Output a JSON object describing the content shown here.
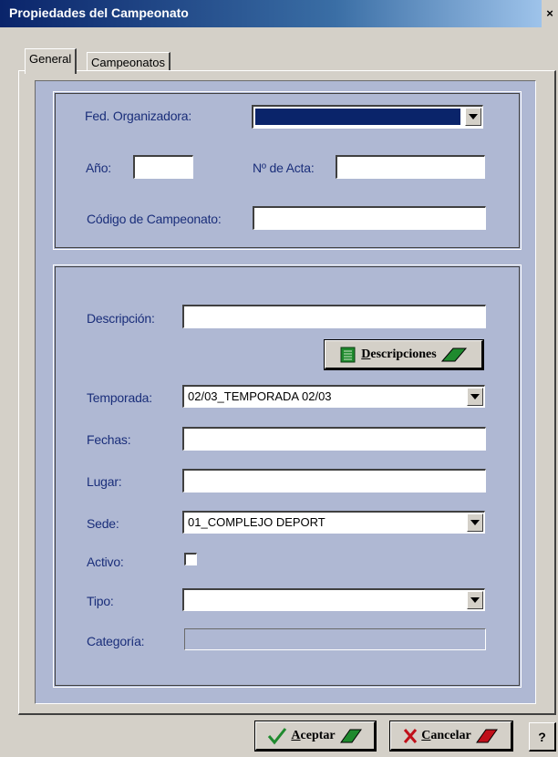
{
  "window": {
    "title": "Propiedades del Campeonato",
    "close_glyph": "×"
  },
  "tabs": [
    {
      "label": "General",
      "active": true
    },
    {
      "label": "Campeonatos",
      "active": false
    }
  ],
  "group1": {
    "fed_label": "Fed. Organizadora:",
    "fed_value": "",
    "anio_label": "Año:",
    "anio_value": "",
    "acta_label": "Nº de Acta:",
    "acta_value": "",
    "codigo_label": "Código de Campeonato:",
    "codigo_value": ""
  },
  "group2": {
    "descripcion_label": "Descripción:",
    "descripcion_value": "",
    "descripciones_button": {
      "mnemonic": "D",
      "rest": "escripciones"
    },
    "temporada_label": "Temporada:",
    "temporada_value": "02/03_TEMPORADA 02/03",
    "fechas_label": "Fechas:",
    "fechas_value": "",
    "lugar_label": "Lugar:",
    "lugar_value": "",
    "sede_label": "Sede:",
    "sede_value": "01_COMPLEJO DEPORT",
    "activo_label": "Activo:",
    "activo_checked": false,
    "tipo_label": "Tipo:",
    "tipo_value": "",
    "categoria_label": "Categoría:",
    "categoria_value": ""
  },
  "footer": {
    "aceptar": {
      "mnemonic": "A",
      "rest": "ceptar"
    },
    "cancelar": {
      "mnemonic": "C",
      "rest": "ancelar"
    },
    "help": "?"
  },
  "icons": {
    "check": "check-icon",
    "cross": "cross-icon",
    "book": "book-icon",
    "pencil": "pencil-icon"
  },
  "colors": {
    "panel_bg": "#afb8d3",
    "label": "#1a2e7a",
    "selection": "#0a246a"
  }
}
